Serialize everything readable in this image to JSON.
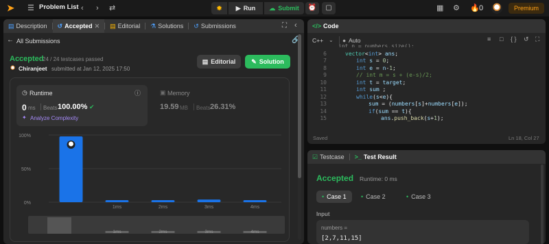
{
  "topbar": {
    "problem_list": "Problem List",
    "run": "Run",
    "submit": "Submit",
    "streak": "0",
    "premium": "Premium"
  },
  "left": {
    "tabs": [
      "Description",
      "Accepted",
      "Editorial",
      "Solutions",
      "Submissions"
    ],
    "all_submissions": "All Submissions",
    "status": "Accepted",
    "testcases": "24 / 24 testcases passed",
    "user": "Chiranjeet",
    "submitted": "submitted at Jan 12, 2025 17:50",
    "editorial_btn": "Editorial",
    "solution_btn": "Solution",
    "runtime_label": "Runtime",
    "runtime_value": "0",
    "runtime_unit": "ms",
    "beats_label": "Beats",
    "runtime_beats": "100.00%",
    "analyze": "Analyze Complexity",
    "memory_label": "Memory",
    "memory_value": "19.59",
    "memory_unit": "MB",
    "memory_beats": "26.31%"
  },
  "chart_data": {
    "type": "bar",
    "categories": [
      "0ms",
      "1ms",
      "2ms",
      "3ms",
      "4ms"
    ],
    "values": [
      98,
      3,
      3,
      4,
      3
    ],
    "ytick_labels": [
      "100%",
      "50%",
      "0%"
    ],
    "xtick_labels": [
      "",
      "1ms",
      "2ms",
      "3ms",
      "4ms"
    ],
    "ylim": [
      0,
      100
    ],
    "colors": {
      "bar": "#1a73e8",
      "bar_selected": "#1a73e8"
    }
  },
  "code": {
    "title": "Code",
    "language": "C++",
    "auto": "Auto",
    "status": "Saved",
    "cursor": "Ln 18, Col 27",
    "line_numbers": [
      "6",
      "7",
      "8",
      "9",
      "10",
      "11",
      "12",
      "13",
      "14",
      "15"
    ],
    "top_partial": "int n = numbers.size();"
  },
  "result": {
    "tab_testcase": "Testcase",
    "tab_result": "Test Result",
    "status": "Accepted",
    "runtime": "Runtime: 0 ms",
    "cases": [
      "Case 1",
      "Case 2",
      "Case 3"
    ],
    "input_label": "Input",
    "var_name": "numbers =",
    "var_value": "[2,7,11,15]"
  }
}
